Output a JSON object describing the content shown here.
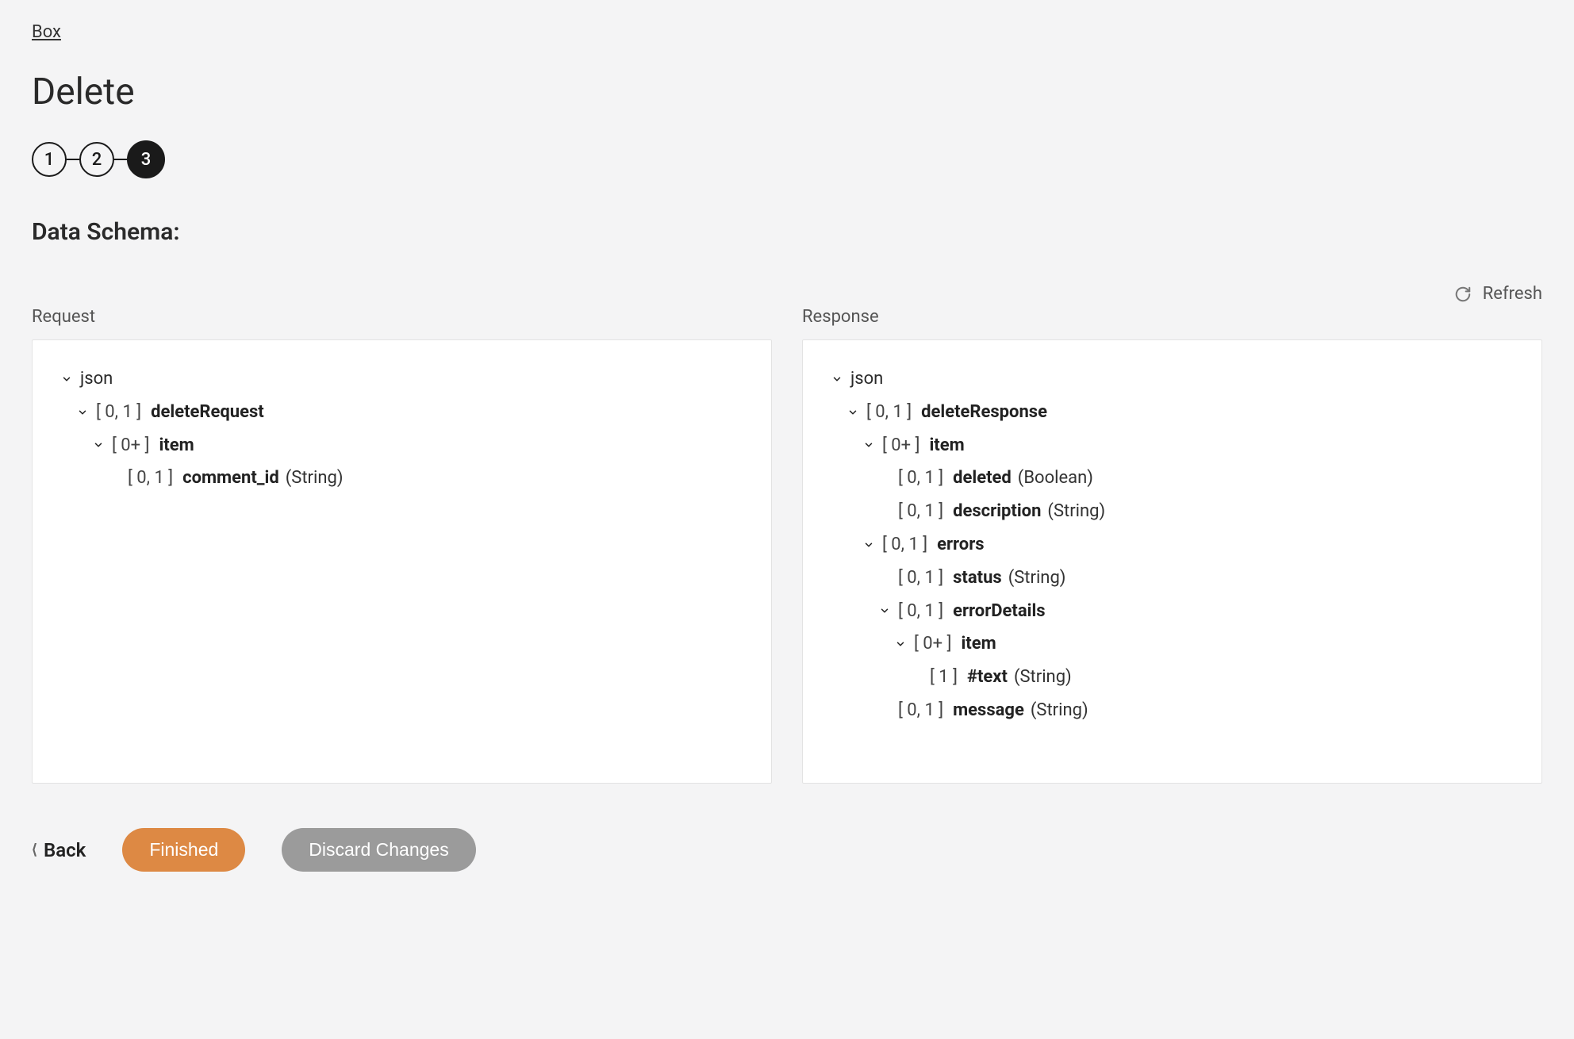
{
  "breadcrumb": "Box",
  "title": "Delete",
  "stepper": {
    "steps": [
      "1",
      "2",
      "3"
    ],
    "active_index": 2
  },
  "section_heading": "Data Schema:",
  "refresh_label": "Refresh",
  "columns": {
    "request_label": "Request",
    "response_label": "Response"
  },
  "request_tree": [
    {
      "indent": 0,
      "chevron": true,
      "card": "",
      "name": "json",
      "type": "",
      "bold": false
    },
    {
      "indent": 1,
      "chevron": true,
      "card": "[ 0, 1 ]",
      "name": "deleteRequest",
      "type": "",
      "bold": true
    },
    {
      "indent": 2,
      "chevron": true,
      "card": "[ 0+ ]",
      "name": "item",
      "type": "",
      "bold": true
    },
    {
      "indent": 3,
      "chevron": false,
      "card": "[ 0, 1 ]",
      "name": "comment_id",
      "type": "(String)",
      "bold": true
    }
  ],
  "response_tree": [
    {
      "indent": 0,
      "chevron": true,
      "card": "",
      "name": "json",
      "type": "",
      "bold": false
    },
    {
      "indent": 1,
      "chevron": true,
      "card": "[ 0, 1 ]",
      "name": "deleteResponse",
      "type": "",
      "bold": true
    },
    {
      "indent": 2,
      "chevron": true,
      "card": "[ 0+ ]",
      "name": "item",
      "type": "",
      "bold": true
    },
    {
      "indent": 3,
      "chevron": false,
      "card": "[ 0, 1 ]",
      "name": "deleted",
      "type": "(Boolean)",
      "bold": true
    },
    {
      "indent": 3,
      "chevron": false,
      "card": "[ 0, 1 ]",
      "name": "description",
      "type": "(String)",
      "bold": true
    },
    {
      "indent": 2,
      "chevron": true,
      "card": "[ 0, 1 ]",
      "name": "errors",
      "type": "",
      "bold": true
    },
    {
      "indent": 3,
      "chevron": false,
      "card": "[ 0, 1 ]",
      "name": "status",
      "type": "(String)",
      "bold": true
    },
    {
      "indent": 3,
      "chevron": true,
      "card": "[ 0, 1 ]",
      "name": "errorDetails",
      "type": "",
      "bold": true
    },
    {
      "indent": 4,
      "chevron": true,
      "card": "[ 0+ ]",
      "name": "item",
      "type": "",
      "bold": true
    },
    {
      "indent": 5,
      "chevron": false,
      "card": "[ 1 ]",
      "name": "#text",
      "type": "(String)",
      "bold": true
    },
    {
      "indent": 3,
      "chevron": false,
      "card": "[ 0, 1 ]",
      "name": "message",
      "type": "(String)",
      "bold": true
    }
  ],
  "footer": {
    "back": "Back",
    "finished": "Finished",
    "discard": "Discard Changes"
  }
}
